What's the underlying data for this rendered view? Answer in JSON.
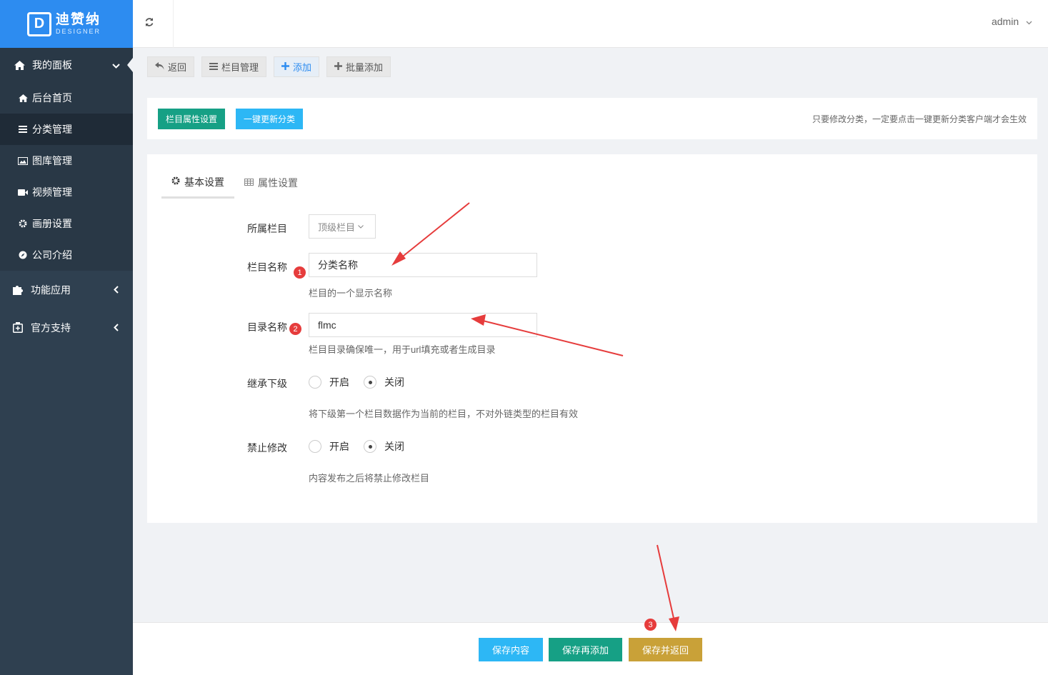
{
  "logo": {
    "cn": "迪赞纳",
    "en": "DESIGNER",
    "mark": "D"
  },
  "sidebar": {
    "group_main": {
      "label": "我的面板",
      "icon": "home-icon",
      "arrow": "⌄"
    },
    "sub_items": [
      {
        "label": "后台首页",
        "icon": "home-icon",
        "glyph": "⌂"
      },
      {
        "label": "分类管理",
        "icon": "list-icon",
        "glyph": "≡"
      },
      {
        "label": "图库管理",
        "icon": "image-icon",
        "glyph": "▣"
      },
      {
        "label": "视频管理",
        "icon": "video-icon",
        "glyph": "■"
      },
      {
        "label": "画册设置",
        "icon": "gear-icon",
        "glyph": "⚙"
      },
      {
        "label": "公司介绍",
        "icon": "compass-icon",
        "glyph": "◍"
      }
    ],
    "group_func": {
      "label": "功能应用",
      "icon": "puzzle-icon",
      "arrow": "‹"
    },
    "group_support": {
      "label": "官方支持",
      "icon": "plus-square-icon",
      "arrow": "‹"
    }
  },
  "header": {
    "user": "admin"
  },
  "toolbar": {
    "back": "返回",
    "manage": "栏目管理",
    "add": "添加",
    "batch_add": "批量添加"
  },
  "card_top": {
    "attr_btn": "栏目属性设置",
    "update_btn": "一键更新分类",
    "hint": "只要修改分类，一定要点击一键更新分类客户端才会生效"
  },
  "tabs": {
    "basic": "基本设置",
    "attr": "属性设置"
  },
  "form": {
    "parent": {
      "label": "所属栏目",
      "value": "顶级栏目"
    },
    "name": {
      "label": "栏目名称",
      "value": "分类名称",
      "help": "栏目的一个显示名称"
    },
    "dir": {
      "label": "目录名称",
      "value": "flmc",
      "help": "栏目目录确保唯一，用于url填充或者生成目录"
    },
    "inherit": {
      "label": "继承下级",
      "on": "开启",
      "off": "关闭",
      "selected": "off",
      "help": "将下级第一个栏目数据作为当前的栏目，不对外链类型的栏目有效"
    },
    "lock": {
      "label": "禁止修改",
      "on": "开启",
      "off": "关闭",
      "selected": "off",
      "help": "内容发布之后将禁止修改栏目"
    }
  },
  "badges": [
    "1",
    "2",
    "3"
  ],
  "footer": {
    "save": "保存内容",
    "save_add": "保存再添加",
    "save_back": "保存并返回"
  },
  "colors": {
    "sidebar": "#2f4050",
    "logo_bg": "#2d8cf0",
    "green": "#16a085",
    "blue": "#2db7f5",
    "gold": "#c9a138",
    "annotation": "#e63c3c"
  }
}
